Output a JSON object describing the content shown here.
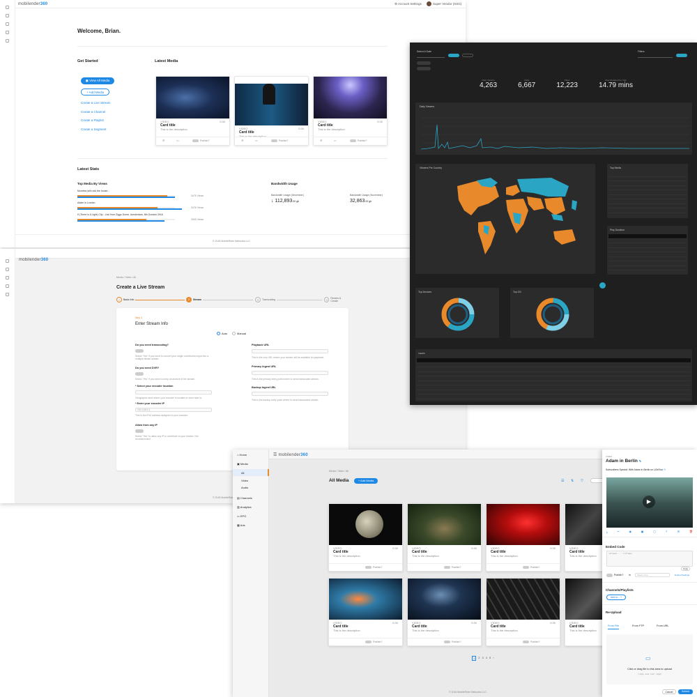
{
  "dashboard": {
    "logo": "mobilender",
    "logo_accent": "360",
    "account": "Account Settings",
    "user": "Super Vendor (SSG)",
    "welcome": "Welcome, Brian.",
    "get_started": "Get Started",
    "latest_media": "Latest Media",
    "view_all": "View All Media",
    "add_media": "Add Media",
    "links": [
      "Create a Live Stream",
      "Create a Channel",
      "Create a Playlist",
      "Create a Segment"
    ],
    "cards": [
      {
        "type": "VIDEO",
        "dur": "0:30",
        "title": "Card title",
        "desc": "This is the description",
        "publish": "Publish?"
      },
      {
        "type": "VIDEO",
        "dur": "0:30",
        "title": "Card title",
        "desc": "This is the description",
        "publish": "Publish?"
      },
      {
        "type": "VIDEO",
        "dur": "0:30",
        "title": "Card title",
        "desc": "This is the description",
        "publish": "Publish?"
      }
    ],
    "latest_stats": "Latest Stats",
    "top_media": "Top Media By Views",
    "media": [
      {
        "name": "Mumbai (will rock the house...",
        "views": "3476 Views",
        "pct": 0.92
      },
      {
        "name": "Adam in London",
        "views": "3476 Views",
        "pct": 0.82
      },
      {
        "name": "If (There Is A Light) Clip - Live from Ziggo Dome, Amsterdam, 6th October 2016",
        "views": "3009 Views",
        "pct": 0.71
      }
    ],
    "bandwidth": "Bandwidth Usage",
    "bw1_label": "Bandwidth Usage (December)",
    "bw1_value": "112,893",
    "bw1_unit": ".00 gb",
    "bw2_label": "Bandwidth Usage (November)",
    "bw2_value": "32,863",
    "bw2_unit": ".00 gb",
    "footer": "© 2018 MobileRider Networks LLC"
  },
  "analytics": {
    "select_date": "Select A Date",
    "filters": "Filters",
    "stats": [
      {
        "value": "4,263",
        "label": "Daily Viewers"
      },
      {
        "value": "6,667",
        "label": "Visits"
      },
      {
        "value": "12,223",
        "label": "Plays"
      },
      {
        "value": "14.79 mins",
        "label": "Play Duration Per Visit"
      }
    ],
    "daily_viewers": "Daily Viewers",
    "viewers_country": "Viewers Per Country",
    "top_media": "Top Media",
    "play_duration": "Play Duration",
    "top_devices": "Top Devices",
    "top_os": "Top OS",
    "views": "VIEWS"
  },
  "stream": {
    "breadcrumb": "Media / Video / All",
    "title": "Create a Live Stream",
    "steps": [
      "Basic Info",
      "Stream",
      "Transcoding",
      "Review & Create"
    ],
    "step_label": "Step 2",
    "section": "Enter Stream Info",
    "auto": "Auto",
    "manual": "Manual",
    "q1": "Do you need transcoding?",
    "q2": "Do you need DVR?",
    "q3": "* Select your encoder location",
    "q4": "* Enter your encoder IP",
    "q5": "Allow from any IP",
    "ip_placeholder": "192.168.0.1",
    "playback": "Playback URL",
    "primary": "Primary Ingest URL",
    "backup": "Backup Ingest URL",
    "footer": "© 2018 MobileRider Networks LLC"
  },
  "media": {
    "nav": [
      "Home",
      "Media",
      "All",
      "Video",
      "Audio",
      "Channels",
      "Analytics",
      "EPG",
      "Ads"
    ],
    "breadcrumb": "Media / Video / All",
    "title": "All Media",
    "add": "Add Media",
    "card_type": "VIDEO",
    "card_dur": "0:30",
    "card_title": "Card title",
    "card_desc": "This is the description",
    "publish": "Publish?",
    "pages": [
      "1",
      "2",
      "3",
      "4",
      "5"
    ],
    "footer": "© 2018 MobileRider Networks LLC"
  },
  "details": {
    "kind": "VIDEO",
    "title": "Adam in Berlin",
    "subtitle": "Subscribers Special: With Adam in Berlin on U2eTour",
    "embed": "Embed Code",
    "publish": "Publish?",
    "in": "in",
    "select_zone": "Select zone",
    "embed_settings": "Embed Settings",
    "copy": "Copy",
    "channels": "Channels/Playlists",
    "add_to": "Add to...",
    "reupload": "Re-Upload",
    "tabs": [
      "From File",
      "From FTP",
      "From URL"
    ],
    "drop": "Click or drag file to this area to upload",
    "drop_sub": "(.mp4, .mov, .mxf ...mp3)",
    "cancel": "Cancel",
    "submit": "Submit"
  },
  "colors": {
    "accent": "#1e88e5",
    "orange": "#e8892b",
    "teal": "#2aa6c4",
    "dark": "#1f1f1f"
  }
}
